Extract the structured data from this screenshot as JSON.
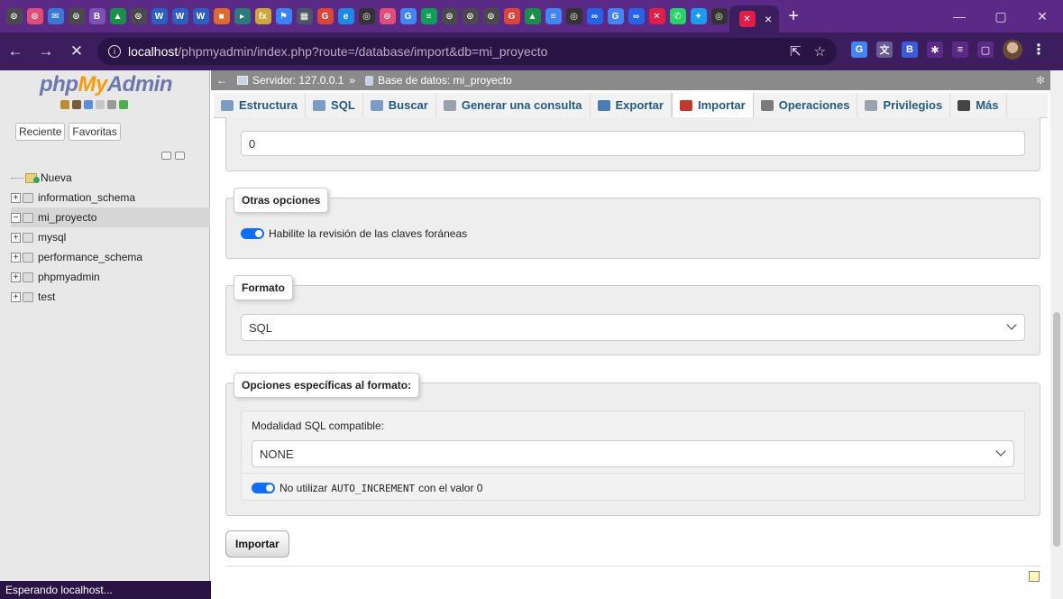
{
  "browser": {
    "tab_close": "×",
    "new_tab": "+",
    "favicons": [
      {
        "name": "chrome-icon",
        "color": "#4a4a4a",
        "glyph": "⊙"
      },
      {
        "name": "app-icon",
        "color": "#e24c79",
        "glyph": "⊙"
      },
      {
        "name": "mail-icon",
        "color": "#3a78d8",
        "glyph": "✉"
      },
      {
        "name": "chrome-icon",
        "color": "#4a4a4a",
        "glyph": "⊙"
      },
      {
        "name": "bootstrap-icon",
        "color": "#7952b3",
        "glyph": "B"
      },
      {
        "name": "drive-icon",
        "color": "#1a8f4a",
        "glyph": "▲"
      },
      {
        "name": "chrome-icon",
        "color": "#4a4a4a",
        "glyph": "⊙"
      },
      {
        "name": "w-icon",
        "color": "#2b5fc0",
        "glyph": "W"
      },
      {
        "name": "w-icon",
        "color": "#2b5fc0",
        "glyph": "W"
      },
      {
        "name": "w-icon",
        "color": "#2b5fc0",
        "glyph": "W"
      },
      {
        "name": "windows-icon",
        "color": "#e0692d",
        "glyph": "■"
      },
      {
        "name": "app-icon",
        "color": "#2c7a7b",
        "glyph": "▸"
      },
      {
        "name": "formula-icon",
        "color": "#d0a63b",
        "glyph": "fx"
      },
      {
        "name": "flag-icon",
        "color": "#3b82f6",
        "glyph": "⚑"
      },
      {
        "name": "grid-icon",
        "color": "#4b5563",
        "glyph": "▦"
      },
      {
        "name": "google-icon",
        "color": "#db4437",
        "glyph": "G"
      },
      {
        "name": "e-icon",
        "color": "#1e88e5",
        "glyph": "e"
      },
      {
        "name": "github-icon",
        "color": "#333333",
        "glyph": "◎"
      },
      {
        "name": "app-icon",
        "color": "#e24c79",
        "glyph": "⊙"
      },
      {
        "name": "translate-icon",
        "color": "#4285f4",
        "glyph": "G"
      },
      {
        "name": "sheets-icon",
        "color": "#0f9d58",
        "glyph": "≡"
      },
      {
        "name": "chrome-icon",
        "color": "#4a4a4a",
        "glyph": "⊙"
      },
      {
        "name": "chrome-icon",
        "color": "#4a4a4a",
        "glyph": "⊙"
      },
      {
        "name": "chrome-icon",
        "color": "#4a4a4a",
        "glyph": "⊙"
      },
      {
        "name": "google-icon",
        "color": "#db4437",
        "glyph": "G"
      },
      {
        "name": "drive-icon",
        "color": "#1a8f4a",
        "glyph": "▲"
      },
      {
        "name": "docs-icon",
        "color": "#4285f4",
        "glyph": "≡"
      },
      {
        "name": "github-icon",
        "color": "#333333",
        "glyph": "◎"
      },
      {
        "name": "infinity-icon",
        "color": "#2563eb",
        "glyph": "∞"
      },
      {
        "name": "translate-icon",
        "color": "#4285f4",
        "glyph": "G"
      },
      {
        "name": "infinity-icon",
        "color": "#2563eb",
        "glyph": "∞"
      },
      {
        "name": "x-icon",
        "color": "#e11d48",
        "glyph": "✕"
      },
      {
        "name": "whatsapp-icon",
        "color": "#25d366",
        "glyph": "✆"
      },
      {
        "name": "twitter-icon",
        "color": "#1d9bf0",
        "glyph": "✦"
      },
      {
        "name": "github-icon",
        "color": "#333333",
        "glyph": "◎"
      }
    ],
    "active_tab_icon": {
      "color": "#e11d48",
      "glyph": "✕"
    },
    "window": {
      "minimize": "—",
      "maximize": "▢",
      "close": "✕"
    },
    "address": {
      "info_glyph": "i",
      "host": "localhost",
      "path": "/phpmyadmin/index.php?route=/database/import&db=mi_proyecto"
    },
    "nav": {
      "back": "←",
      "forward": "→",
      "stop": "✕"
    },
    "omnibox_icons": {
      "share": "⇱",
      "star": "☆"
    },
    "extensions": [
      {
        "name": "translate-icon",
        "color": "#4285f4",
        "glyph": "G"
      },
      {
        "name": "dictionary-icon",
        "color": "#6b5b95",
        "glyph": "文"
      },
      {
        "name": "b-icon",
        "color": "#3b5bdb",
        "glyph": "B"
      },
      {
        "name": "puzzle-icon",
        "color": "#5b2a86",
        "glyph": "✱"
      },
      {
        "name": "queue-icon",
        "color": "#5b2a86",
        "glyph": "≡"
      },
      {
        "name": "sidepanel-icon",
        "color": "#5b2a86",
        "glyph": "▢"
      }
    ],
    "status_text": "Esperando localhost..."
  },
  "sidebar": {
    "logo_php": "php",
    "logo_my": "My",
    "logo_admin": "Admin",
    "tabs": [
      "Reciente",
      "Favoritas"
    ],
    "new_label": "Nueva",
    "databases": [
      {
        "name": "information_schema",
        "expander": "+",
        "selected": false
      },
      {
        "name": "mi_proyecto",
        "expander": "−",
        "selected": true
      },
      {
        "name": "mysql",
        "expander": "+",
        "selected": false
      },
      {
        "name": "performance_schema",
        "expander": "+",
        "selected": false
      },
      {
        "name": "phpmyadmin",
        "expander": "+",
        "selected": false
      },
      {
        "name": "test",
        "expander": "+",
        "selected": false
      }
    ]
  },
  "breadcrumb": {
    "server": "Servidor: 127.0.0.1",
    "sep": "»",
    "database": "Base de datos: mi_proyecto"
  },
  "menu": [
    {
      "label": "Estructura",
      "name": "tab-estructura",
      "icon_color": "#7a9cc6"
    },
    {
      "label": "SQL",
      "name": "tab-sql",
      "icon_color": "#7a9cc6"
    },
    {
      "label": "Buscar",
      "name": "tab-buscar",
      "icon_color": "#7a9cc6"
    },
    {
      "label": "Generar una consulta",
      "name": "tab-generar-consulta",
      "icon_color": "#9aa3ad"
    },
    {
      "label": "Exportar",
      "name": "tab-exportar",
      "icon_color": "#4b7bb5"
    },
    {
      "label": "Importar",
      "name": "tab-importar",
      "icon_color": "#c0392b"
    },
    {
      "label": "Operaciones",
      "name": "tab-operaciones",
      "icon_color": "#7a7a7a"
    },
    {
      "label": "Privilegios",
      "name": "tab-privilegios",
      "icon_color": "#9aa3ad"
    },
    {
      "label": "Más",
      "name": "tab-mas",
      "icon_color": "#444444"
    }
  ],
  "form": {
    "skip_value": "0",
    "other_options": {
      "legend": "Otras opciones",
      "foreign_keys_label": "Habilite la revisión de las claves foráneas"
    },
    "format": {
      "legend": "Formato",
      "selected": "SQL"
    },
    "format_specific": {
      "legend": "Opciones específicas al formato:",
      "sql_mode_label": "Modalidad SQL compatible:",
      "sql_mode_selected": "NONE",
      "auto_increment_prefix": "No utilizar",
      "auto_increment_code": "AUTO_INCREMENT",
      "auto_increment_suffix": "con el valor 0"
    },
    "submit_label": "Importar"
  }
}
